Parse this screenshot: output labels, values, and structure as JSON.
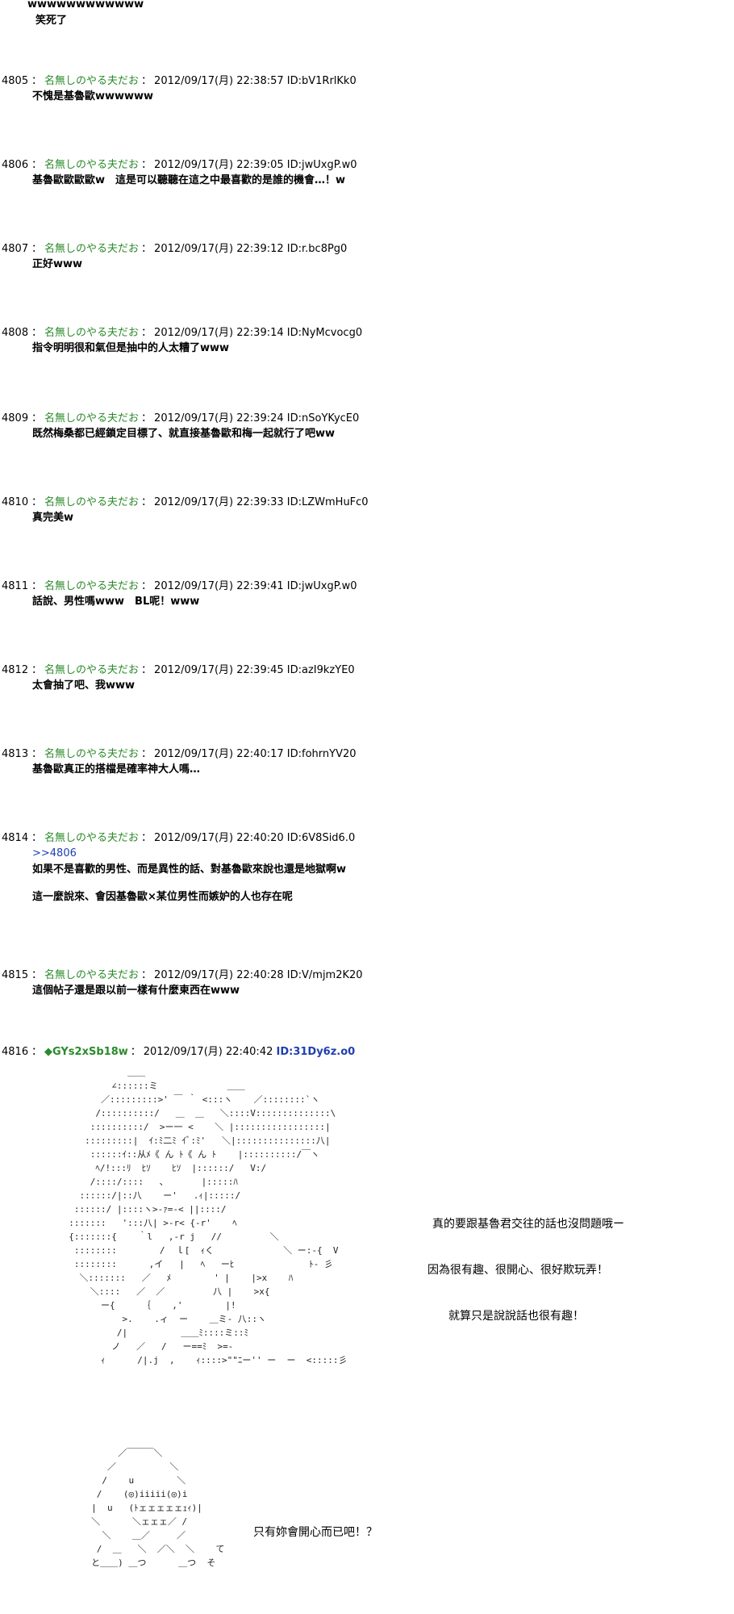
{
  "top_text": [
    "wwwwwwwwwwww",
    "笑死了"
  ],
  "posts": [
    {
      "num": "4805",
      "name": "名無しのやる夫だお",
      "datetime": "2012/09/17(月) 22:38:57",
      "id": "ID:bV1RrlKk0",
      "lines": [
        "不愧是基魯歐wwwwww"
      ]
    },
    {
      "num": "4806",
      "name": "名無しのやる夫だお",
      "datetime": "2012/09/17(月) 22:39:05",
      "id": "ID:jwUxgP.w0",
      "lines": [
        "基魯歐歐歐歐w　這是可以聽聽在這之中最喜歡的是誰的機會…！w"
      ]
    },
    {
      "num": "4807",
      "name": "名無しのやる夫だお",
      "datetime": "2012/09/17(月) 22:39:12",
      "id": "ID:r.bc8Pg0",
      "lines": [
        "正好www"
      ]
    },
    {
      "num": "4808",
      "name": "名無しのやる夫だお",
      "datetime": "2012/09/17(月) 22:39:14",
      "id": "ID:NyMcvocg0",
      "lines": [
        "指令明明很和氣但是抽中的人太糟了www"
      ]
    },
    {
      "num": "4809",
      "name": "名無しのやる夫だお",
      "datetime": "2012/09/17(月) 22:39:24",
      "id": "ID:nSoYKycE0",
      "lines": [
        "既然梅桑都已經鎖定目標了、就直接基魯歐和梅一起就行了吧ww"
      ]
    },
    {
      "num": "4810",
      "name": "名無しのやる夫だお",
      "datetime": "2012/09/17(月) 22:39:33",
      "id": "ID:LZWmHuFc0",
      "lines": [
        "真完美w"
      ]
    },
    {
      "num": "4811",
      "name": "名無しのやる夫だお",
      "datetime": "2012/09/17(月) 22:39:41",
      "id": "ID:jwUxgP.w0",
      "lines": [
        "話說、男性嗎www　BL呢！www"
      ]
    },
    {
      "num": "4812",
      "name": "名無しのやる夫だお",
      "datetime": "2012/09/17(月) 22:39:45",
      "id": "ID:azI9kzYE0",
      "lines": [
        "太會抽了吧、我www"
      ]
    },
    {
      "num": "4813",
      "name": "名無しのやる夫だお",
      "datetime": "2012/09/17(月) 22:40:17",
      "id": "ID:fohrnYV20",
      "lines": [
        "基魯歐真正的搭檔是確率神大人嗎…"
      ]
    },
    {
      "num": "4814",
      "name": "名無しのやる夫だお",
      "datetime": "2012/09/17(月) 22:40:20",
      "id": "ID:6V8Sid6.0",
      "anchor": ">>4806",
      "lines": [
        "如果不是喜歡的男性、而是異性的話、對基魯歐來說也還是地獄啊w"
      ],
      "lines2": [
        "這一麼說來、會因基魯歐×某位男性而嫉妒的人也存在呢"
      ]
    },
    {
      "num": "4815",
      "name": "名無しのやる夫だお",
      "datetime": "2012/09/17(月) 22:40:28",
      "id": "ID:V/mjm2K20",
      "lines": [
        "這個帖子還是跟以前一樣有什麼東西在www"
      ]
    }
  ],
  "post_4816": {
    "num": "4816",
    "trip": "◆GYs2xSb18w",
    "datetime": "2012/09/17(月) 22:40:42",
    "id": "ID:31Dy6z.o0"
  },
  "aa_dialog": [
    "真的要跟基魯君交往的話也沒問題哦ー",
    "因為很有趣、很開心、很好欺玩弄！",
    "就算只是說說話也很有趣！",
    "只有妳會開心而已吧！？"
  ],
  "ascii_art_1": "             ＿＿\n          ∠::::::ミ             ＿＿\n        ／:::::::::>' ￣ ｀ <:::ヽ    ／::::::::`ヽ\n       /::::::::::/   ＿  ＿   ＼::::V::::::::::::::\\\n      ::::::::::/  >ー一 <    ＼ |:::::::::::::::::|\n     :::::::::|  ｲ:ﾐ二ﾐ ｲﾞ:ﾐ'   ＼|:::::::::::::::八|\n      ::::::ｲ::从ﾒ《 ん ﾄ《 ん ﾄ    |::::::::::/￣ヽ\n       ﾍ/!:::ﾘ  ﾋｿ    ﾋｿ  |::::::/   V:/\n      /::::/::::   ､       |:::::ﾊ\n    ::::::/|::八    ー'   .ｨ|:::::/\n   ::::::/ |::::ヽ>-ｧ=‐< ||::::/\n  :::::::   ':::八| >-r< {-r'    ﾍ\n  {:::::::{    ｀l   ,-r j   //         ＼\n   ::::::::        /  ｌ[  ｨく             ＼ ー:-{  V\n   ::::::::      ,イ   |   ﾍ   ーﾋ              ﾄ- 彡\n    ＼:::::::   ／   ﾒ        ' |    |>x    ﾊ\n      ＼::::   ／  ／         八 |    >x{\n        ー{     ｛    ,'        |!\n            >.    .ィ  ー    ＿ミ- 八::ヽ\n           /|          ＿＿ﾐ::::ミ::ﾐ\n          ノ   ／   /   ー==ﾐ  >=-\n        ｨ      /|.j  ,    ｨ::::>\"\"ﾆー'' ー  ー  <:::::彡",
  "ascii_art_2": "          ／￣￣￣＼\n        ／          ＼\n       /    u        ＼\n      /    (◎)iiiii(◎)i\n     |  u   (ﾄェェェェェｪｨ)|\n     ＼      ＼ェェェ／ /\n       ＼    ＿／     ／\n      /  ＿   ＼  ／＼  ＼    て\n     と＿＿) ＿つ      ＿つ  そ"
}
